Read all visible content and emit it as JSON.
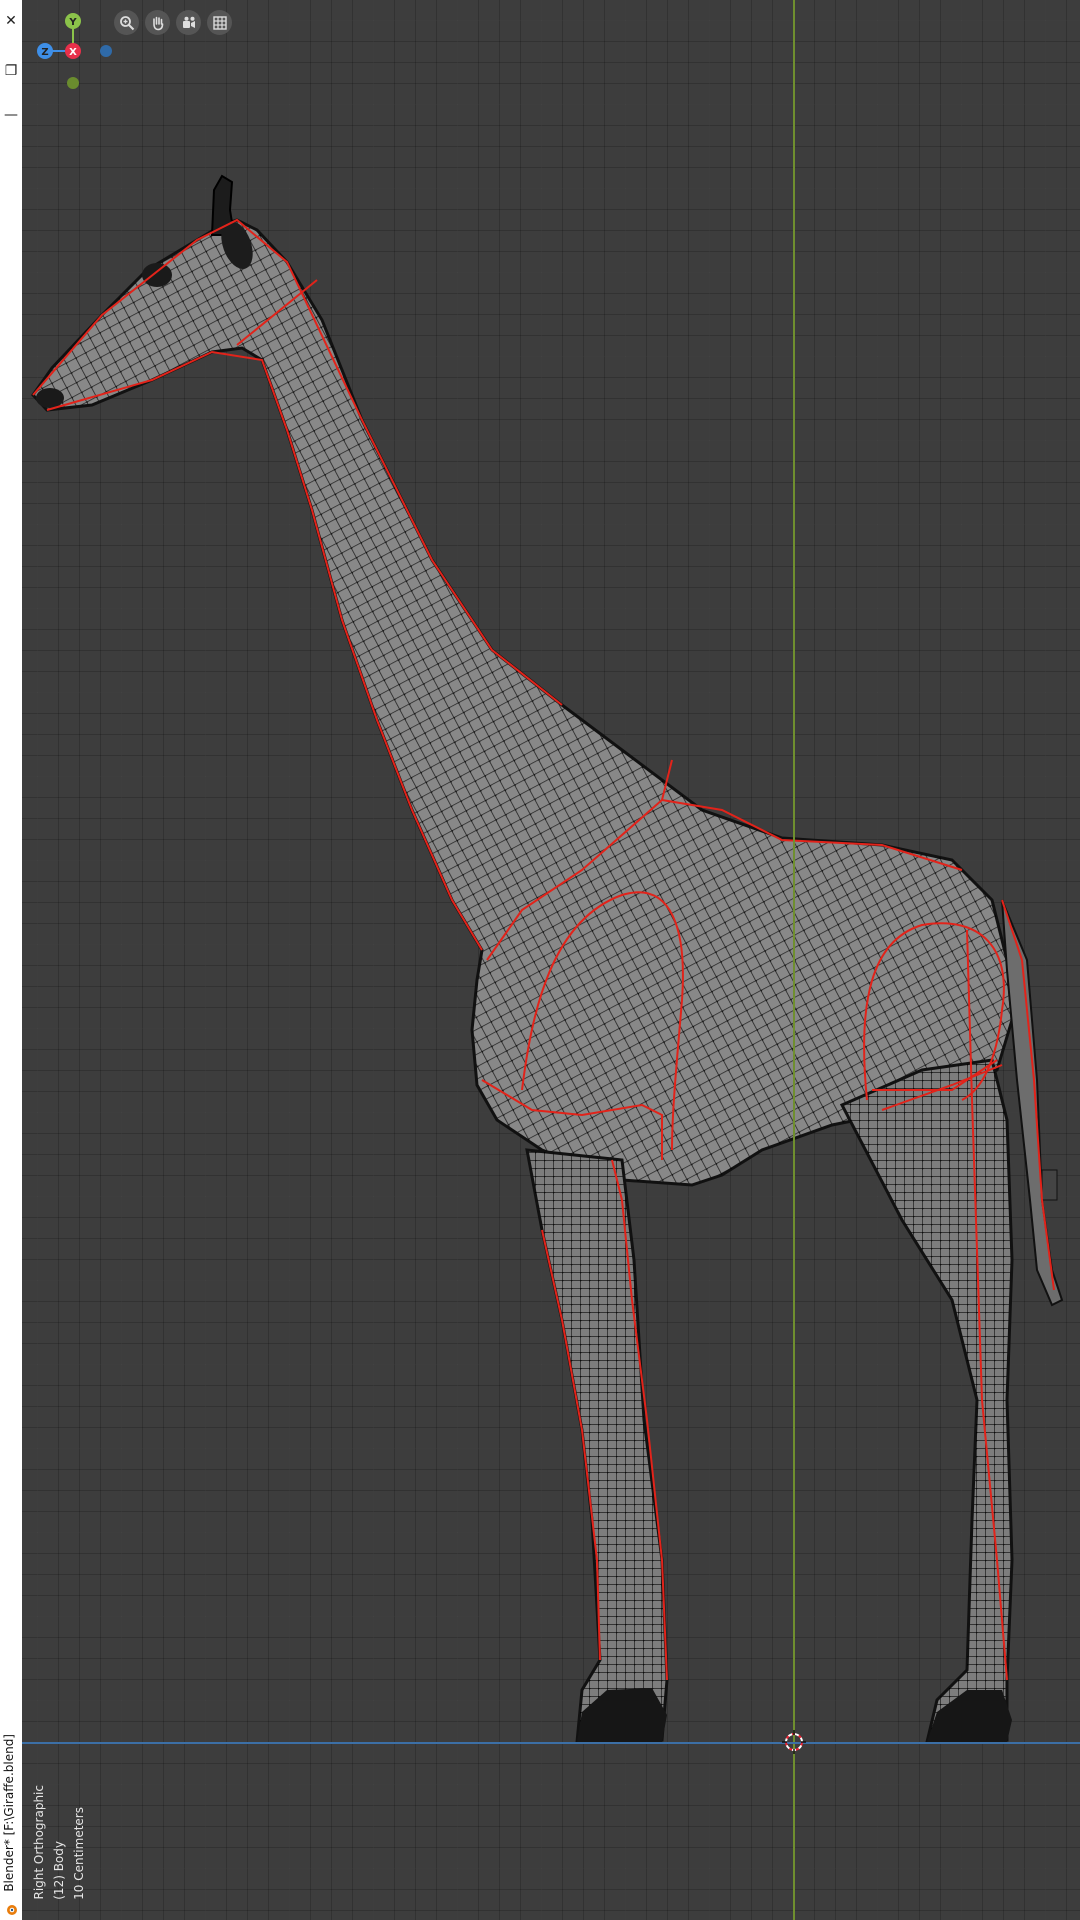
{
  "window": {
    "title": "Blender* [F:\\Giraffe.blend]",
    "controls": [
      {
        "name": "close-icon",
        "glyph": "✕"
      },
      {
        "name": "restore-icon",
        "glyph": "❐"
      },
      {
        "name": "minimize-icon",
        "glyph": "—"
      }
    ]
  },
  "viewport": {
    "view_name": "Right Orthographic",
    "object_info": "(12) Body",
    "grid_scale": "10 Centimeters"
  },
  "gizmo": {
    "axes": [
      {
        "label": "Y",
        "color": "#8bc34a"
      },
      {
        "label": "Z",
        "color": "#3e8fe8"
      },
      {
        "label": "X",
        "color": "#e8304a"
      }
    ]
  },
  "nav_tools": [
    {
      "icon": "zoom-icon"
    },
    {
      "icon": "pan-hand-icon"
    },
    {
      "icon": "camera-view-icon"
    },
    {
      "icon": "grid-ortho-icon"
    }
  ],
  "colors": {
    "grid_bg": "#3d3d3d",
    "mesh_fill": "#8a8a8a",
    "wire": "#111111",
    "seam": "#e2231a",
    "y_axis": "#6f8f2f",
    "floor_axis": "#3c6fa6"
  }
}
